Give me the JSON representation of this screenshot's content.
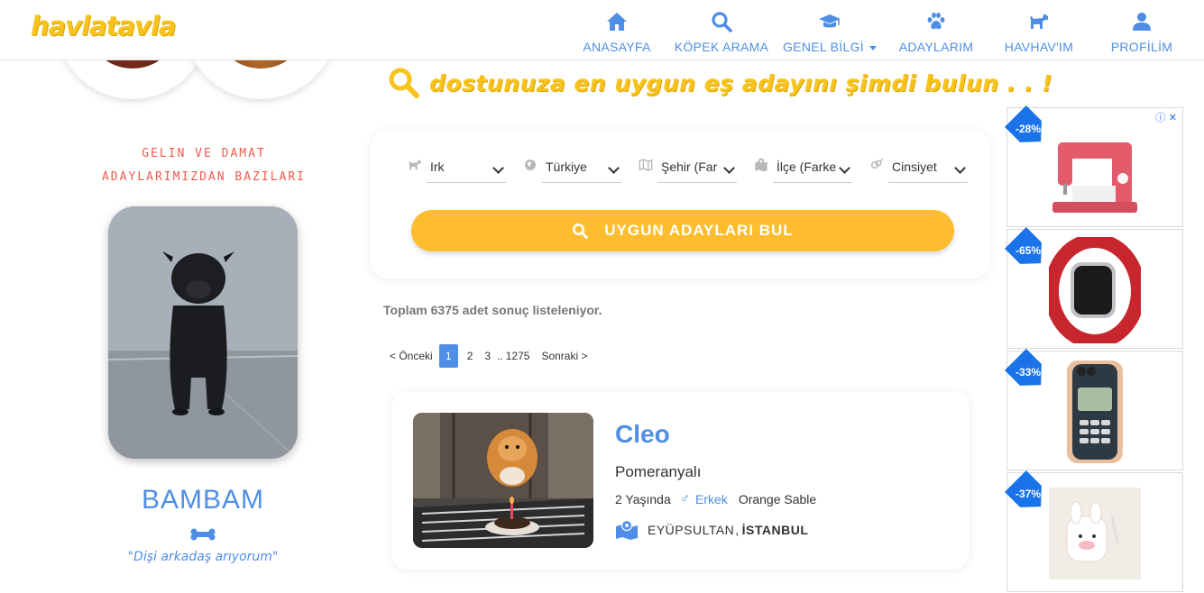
{
  "brand": {
    "logo_text": "havlatavla",
    "logo_color": "#f7c31c"
  },
  "nav": {
    "items": [
      {
        "label": "ANASAYFA",
        "icon": "home-icon"
      },
      {
        "label": "KÖPEK ARAMA",
        "icon": "search-icon"
      },
      {
        "label": "GENEL BİLGİ",
        "icon": "graduation-cap-icon"
      },
      {
        "label": "ADAYLARIM",
        "icon": "paw-icon"
      },
      {
        "label": "HAVHAV'IM",
        "icon": "dog-icon"
      },
      {
        "label": "PROFİLİM",
        "icon": "user-icon"
      }
    ],
    "color": "#4f8ee5"
  },
  "sidebar": {
    "tagline_line1": "GELIN VE DAMAT",
    "tagline_line2": "ADAYLARIMIZDAN BAZILARI",
    "featured_dog": {
      "name": "BAMBAM",
      "quote": "\"Dişi arkadaş arıyorum\""
    }
  },
  "search": {
    "heading": "dostunuza en uygun eş adayını şimdi bulun . . !",
    "filters": [
      {
        "value": "Irk",
        "icon": "dog-icon"
      },
      {
        "value": "Türkiye",
        "icon": "globe-icon"
      },
      {
        "value": "Şehir (Far",
        "icon": "map-icon"
      },
      {
        "value": "İlçe (Farke",
        "icon": "map-marker-icon"
      },
      {
        "value": "Cinsiyet",
        "icon": "gender-icon"
      }
    ],
    "button_label": "UYGUN ADAYLARI BUL",
    "button_color": "#fdbd2e"
  },
  "results": {
    "count_text": "Toplam 6375 adet sonuç listeleniyor.",
    "pagination": {
      "prev": "< Önceki",
      "pages": [
        "1",
        "2",
        "3"
      ],
      "ellipsis": "..",
      "last": "1275",
      "next": "Sonraki >",
      "active": "1"
    },
    "items": [
      {
        "name": "Cleo",
        "breed": "Pomeranyalı",
        "age": "2 Yaşında",
        "gender_symbol": "♂",
        "gender": "Erkek",
        "color": "Orange Sable",
        "district": "EYÜPSULTAN",
        "separator": ",",
        "city": "İSTANBUL"
      }
    ]
  },
  "ads": [
    {
      "discount": "-28%",
      "product": "sewing-machine"
    },
    {
      "discount": "-65%",
      "product": "smart-watch"
    },
    {
      "discount": "-33%",
      "product": "phone-case"
    },
    {
      "discount": "-37%",
      "product": "earbuds-case"
    }
  ],
  "ad_choice_icon": "info-icon"
}
